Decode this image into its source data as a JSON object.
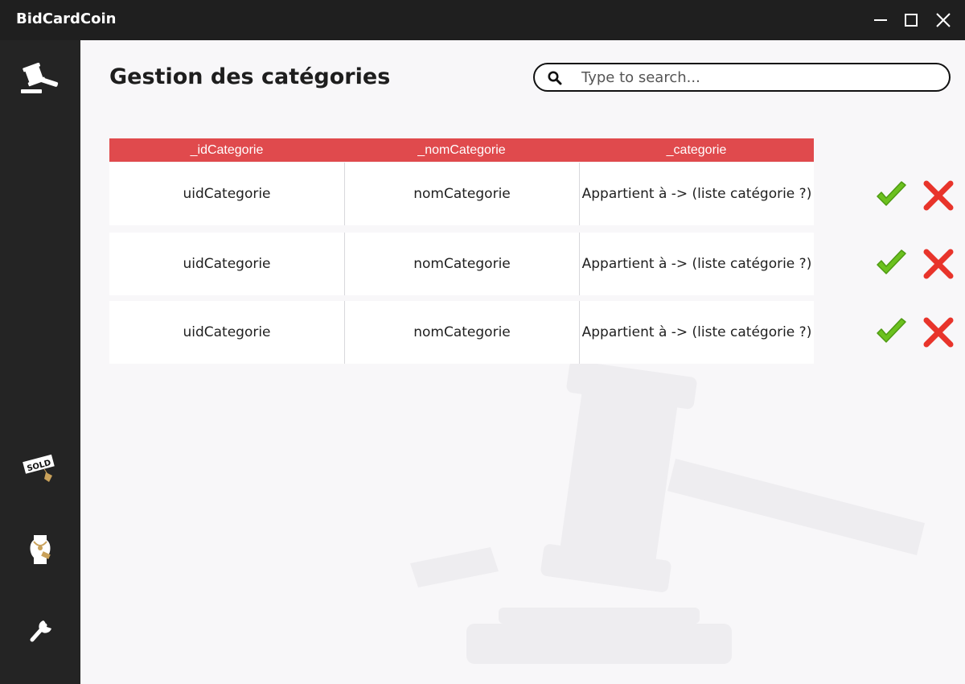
{
  "window": {
    "title": "BidCardCoin",
    "minimize_icon": "minimize-icon",
    "maximize_icon": "maximize-icon",
    "close_icon": "close-icon"
  },
  "sidebar": {
    "items": [
      {
        "icon": "gavel-icon"
      },
      {
        "icon": "sold-tag-icon",
        "tag_text": "SOLD"
      },
      {
        "icon": "jewelry-bust-icon"
      },
      {
        "icon": "wrench-icon"
      }
    ]
  },
  "main": {
    "title": "Gestion des catégories",
    "search": {
      "placeholder": "Type to search...",
      "value": ""
    },
    "table": {
      "columns": [
        "_idCategorie",
        "_nomCategorie",
        "_categorie"
      ],
      "rows": [
        {
          "id": "uidCategorie",
          "nom": "nomCategorie",
          "categorie": "Appartient à -> (liste catégorie ?)"
        },
        {
          "id": "uidCategorie",
          "nom": "nomCategorie",
          "categorie": "Appartient à -> (liste catégorie ?)"
        },
        {
          "id": "uidCategorie",
          "nom": "nomCategorie",
          "categorie": "Appartient à -> (liste catégorie ?)"
        }
      ]
    }
  },
  "colors": {
    "titlebar": "#1f1f1f",
    "sidebar": "#242424",
    "table_header": "#e04a4d",
    "confirm": "#6cc11f",
    "delete": "#e8342b",
    "background": "#f8f7f9"
  }
}
